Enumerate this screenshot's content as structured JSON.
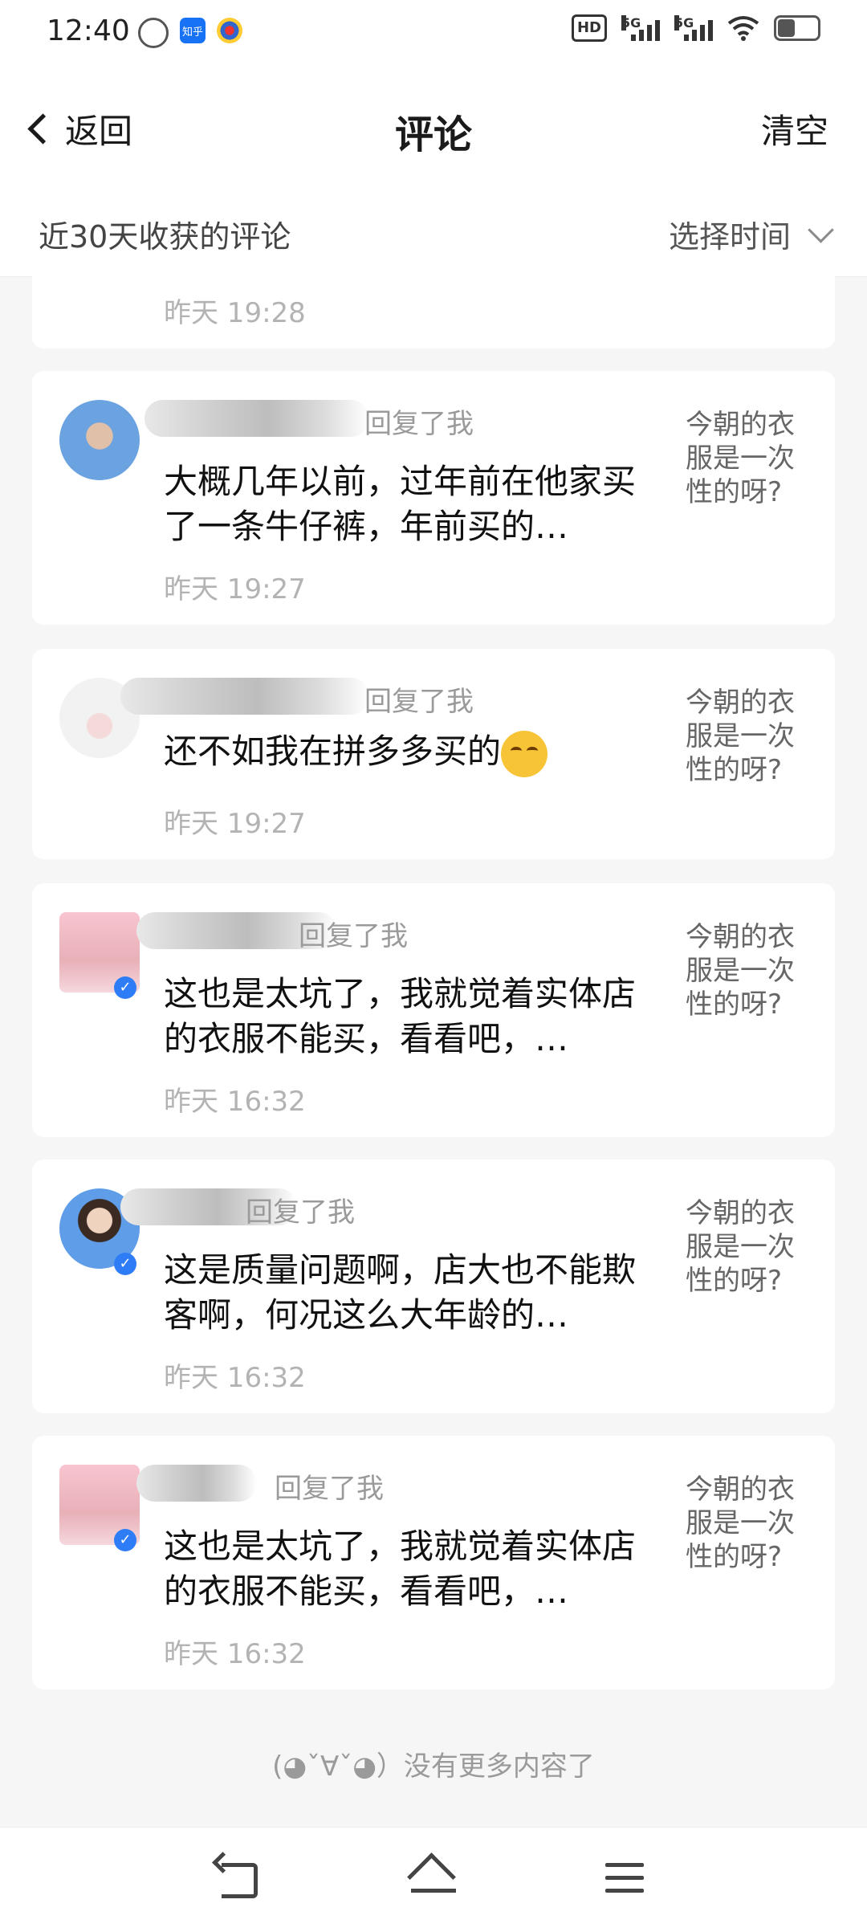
{
  "status_bar": {
    "time": "12:40",
    "app_icons": [
      "sync-icon",
      "zhihu-icon",
      "browser-icon"
    ],
    "zhihu_label": "知乎",
    "hd_label": "HD",
    "signal_labels": [
      "5G",
      "5G"
    ]
  },
  "header": {
    "back_label": "返回",
    "title": "评论",
    "clear_label": "清空"
  },
  "filter": {
    "label": "近30天收获的评论",
    "time_picker_label": "选择时间"
  },
  "partial_item": {
    "time": "昨天 19:28"
  },
  "comments": [
    {
      "replied": "回复了我",
      "content": "大概几年以前，过年前在他家买了一条牛仔裤，年前买的…",
      "time": "昨天 19:27",
      "ref": "今朝的衣服是一次性的呀?"
    },
    {
      "replied": "回复了我",
      "content": "还不如我在拼多多买的",
      "emoji": "tears-of-joy-emoji",
      "time": "昨天 19:27",
      "ref": "今朝的衣服是一次性的呀?"
    },
    {
      "replied": "回复了我",
      "content": "这也是太坑了，我就觉着实体店的衣服不能买，看看吧，…",
      "time": "昨天 16:32",
      "ref": "今朝的衣服是一次性的呀?"
    },
    {
      "replied": "回复了我",
      "content": "这是质量问题啊，店大也不能欺客啊，何况这么大年龄的…",
      "time": "昨天 16:32",
      "ref": "今朝的衣服是一次性的呀?"
    },
    {
      "replied": "回复了我",
      "content": "这也是太坑了，我就觉着实体店的衣服不能买，看看吧，…",
      "time": "昨天 16:32",
      "ref": "今朝的衣服是一次性的呀?"
    }
  ],
  "footer_note": "(◕ˇ∀ˇ◕）没有更多内容了",
  "nav": {
    "buttons": [
      "back-nav",
      "home-nav",
      "menu-nav"
    ]
  }
}
